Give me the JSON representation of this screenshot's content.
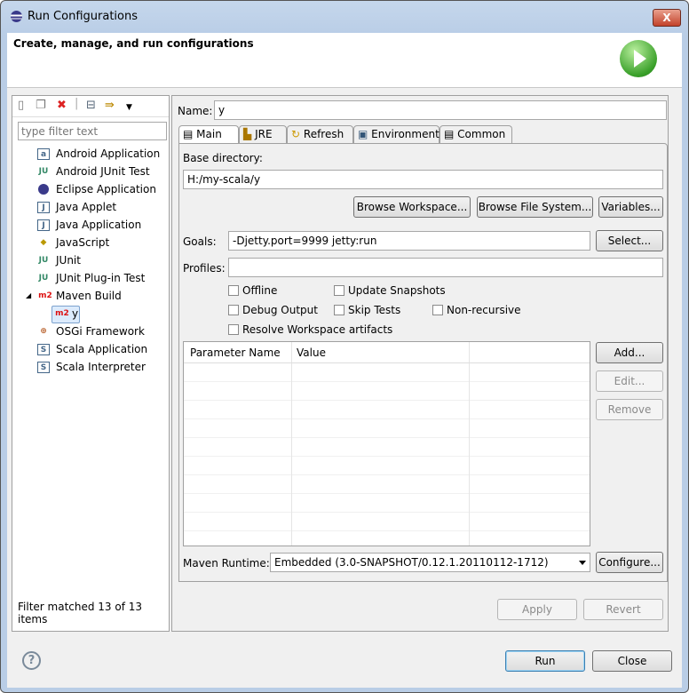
{
  "window": {
    "title": "Run Configurations",
    "close": "X"
  },
  "header": {
    "title": "Create, manage, and run configurations"
  },
  "left": {
    "filter_placeholder": "type filter text",
    "items": [
      {
        "label": "Android Application",
        "icon": "android-app-icon"
      },
      {
        "label": "Android JUnit Test",
        "icon": "android-junit-icon"
      },
      {
        "label": "Eclipse Application",
        "icon": "eclipse-icon"
      },
      {
        "label": "Java Applet",
        "icon": "java-applet-icon"
      },
      {
        "label": "Java Application",
        "icon": "java-app-icon"
      },
      {
        "label": "JavaScript",
        "icon": "javascript-icon"
      },
      {
        "label": "JUnit",
        "icon": "junit-icon"
      },
      {
        "label": "JUnit Plug-in Test",
        "icon": "junit-plugin-icon"
      },
      {
        "label": "Maven Build",
        "icon": "maven-icon"
      },
      {
        "label": "y",
        "icon": "maven-icon"
      },
      {
        "label": "OSGi Framework",
        "icon": "osgi-icon"
      },
      {
        "label": "Scala Application",
        "icon": "scala-icon"
      },
      {
        "label": "Scala Interpreter",
        "icon": "scala-icon"
      }
    ],
    "maven_badge": "m2",
    "status": "Filter matched 13 of 13 items"
  },
  "config": {
    "name_label": "Name:",
    "name_value": "y",
    "tabs": [
      "Main",
      "JRE",
      "Refresh",
      "Environment",
      "Common"
    ],
    "base_dir_label": "Base directory:",
    "base_dir_value": "H:/my-scala/y",
    "browse_workspace": "Browse Workspace...",
    "browse_fs": "Browse File System...",
    "variables": "Variables...",
    "goals_label": "Goals:",
    "goals_value": "-Djetty.port=9999 jetty:run",
    "select": "Select...",
    "profiles_label": "Profiles:",
    "profiles_value": "",
    "checks": {
      "offline": "Offline",
      "update_snapshots": "Update Snapshots",
      "debug_output": "Debug Output",
      "skip_tests": "Skip Tests",
      "non_recursive": "Non-recursive",
      "resolve_workspace": "Resolve Workspace artifacts"
    },
    "table_headers": [
      "Parameter Name",
      "Value"
    ],
    "add": "Add...",
    "edit": "Edit...",
    "remove": "Remove",
    "runtime_label": "Maven Runtime:",
    "runtime_value": "Embedded (3.0-SNAPSHOT/0.12.1.20110112-1712)",
    "configure": "Configure...",
    "apply": "Apply",
    "revert": "Revert"
  },
  "footer": {
    "help": "?",
    "run": "Run",
    "close": "Close"
  }
}
